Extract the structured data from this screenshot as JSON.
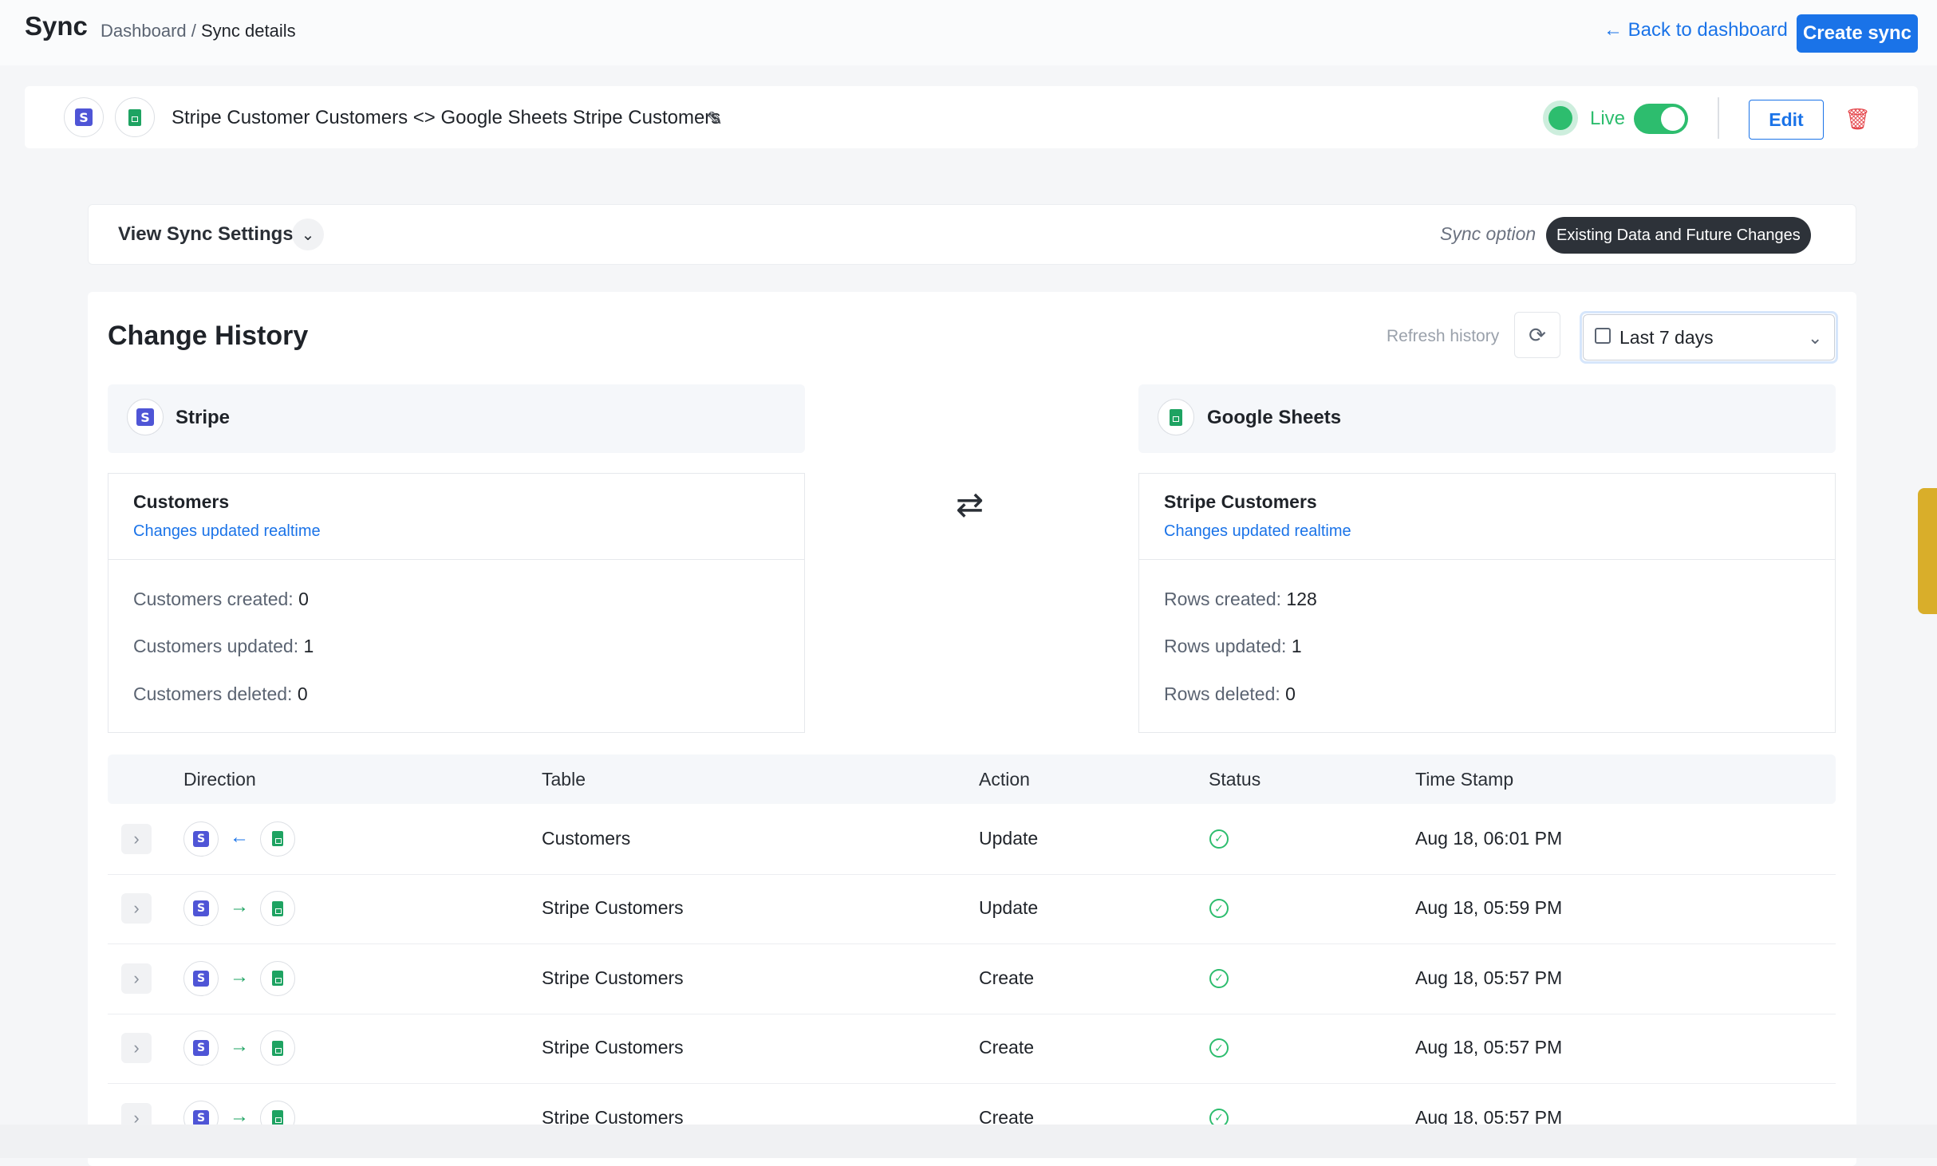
{
  "header": {
    "app_title": "Sync",
    "breadcrumb_root": "Dashboard",
    "breadcrumb_sep": " / ",
    "breadcrumb_current": "Sync details",
    "back_link": "← Back to dashboard",
    "create_button": "Create sync"
  },
  "sync": {
    "name": "Stripe Customer Customers <> Google Sheets Stripe Customers",
    "status_label": "Live",
    "live_enabled": true,
    "edit_button": "Edit"
  },
  "settings": {
    "toggle_label": "View Sync Settings",
    "sync_option_label": "Sync option",
    "sync_option_value": "Existing Data and Future Changes"
  },
  "history": {
    "title": "Change History",
    "refresh_label": "Refresh history",
    "range_value": "Last 7 days",
    "left": {
      "app_name": "Stripe",
      "object_name": "Customers",
      "sub_label": "Changes updated realtime",
      "stats": [
        {
          "label": "Customers created: ",
          "value": "0"
        },
        {
          "label": "Customers updated: ",
          "value": "1"
        },
        {
          "label": "Customers deleted: ",
          "value": "0"
        }
      ]
    },
    "right": {
      "app_name": "Google Sheets",
      "object_name": "Stripe Customers",
      "sub_label": "Changes updated realtime",
      "stats": [
        {
          "label": "Rows created: ",
          "value": "128"
        },
        {
          "label": "Rows updated: ",
          "value": "1"
        },
        {
          "label": "Rows deleted: ",
          "value": "0"
        }
      ]
    }
  },
  "table": {
    "columns": [
      "Direction",
      "Table",
      "Action",
      "Status",
      "Time Stamp"
    ],
    "rows": [
      {
        "direction": "sheets-to-stripe",
        "table": "Customers",
        "action": "Update",
        "status": "success",
        "timestamp": "Aug 18, 06:01 PM"
      },
      {
        "direction": "stripe-to-sheets",
        "table": "Stripe Customers",
        "action": "Update",
        "status": "success",
        "timestamp": "Aug 18, 05:59 PM"
      },
      {
        "direction": "stripe-to-sheets",
        "table": "Stripe Customers",
        "action": "Create",
        "status": "success",
        "timestamp": "Aug 18, 05:57 PM"
      },
      {
        "direction": "stripe-to-sheets",
        "table": "Stripe Customers",
        "action": "Create",
        "status": "success",
        "timestamp": "Aug 18, 05:57 PM"
      },
      {
        "direction": "stripe-to-sheets",
        "table": "Stripe Customers",
        "action": "Create",
        "status": "success",
        "timestamp": "Aug 18, 05:57 PM"
      }
    ]
  },
  "icons": {
    "stripe_glyph": "S",
    "arrow_left": "←",
    "arrow_right": "→",
    "chevron_right": "›",
    "chevron_down": "⌄",
    "check": "✓",
    "swap": "⇄",
    "refresh": "⟳",
    "pencil": "✎",
    "trash": "🗑"
  },
  "colors": {
    "accent": "#1a73e8",
    "live_green": "#2dbd6e",
    "stripe_purple": "#4f55d6",
    "sheets_green": "#1ea362",
    "danger": "#e5484d"
  }
}
